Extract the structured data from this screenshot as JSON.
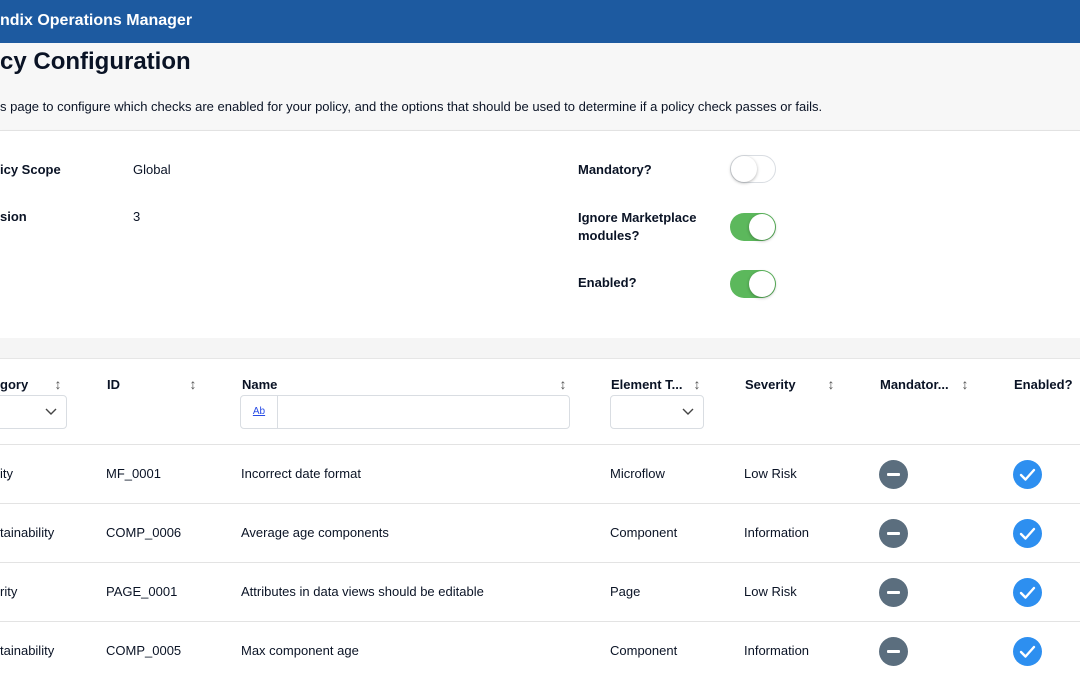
{
  "app": {
    "title": "ndix Operations Manager",
    "header_color": "#1d5aa0"
  },
  "page": {
    "title": "cy Configuration",
    "description": "s page to configure which checks are enabled for your policy, and the options that should be used to determine if a policy check passes or fails."
  },
  "settings": {
    "scope_label": "icy Scope",
    "scope_value": "Global",
    "version_label": "sion",
    "version_value": "3",
    "mandatory_label": "Mandatory?",
    "mandatory_on": false,
    "ignore_label_line1": "Ignore Marketplace",
    "ignore_label_line2": "modules?",
    "ignore_on": true,
    "enabled_label": "Enabled?",
    "enabled_on": true,
    "toggle_on_color": "#5cb85c"
  },
  "table": {
    "columns": {
      "category": "gory",
      "id": "ID",
      "name": "Name",
      "element_type": "Element T...",
      "severity": "Severity",
      "mandatory": "Mandator...",
      "enabled": "Enabled?"
    },
    "name_filter_button": "Ab",
    "name_filter_value": "",
    "category_filter_value": "",
    "element_type_filter_value": "",
    "rows": [
      {
        "category": "ity",
        "id": "MF_0001",
        "name": "Incorrect date format",
        "element_type": "Microflow",
        "severity": "Low Risk",
        "mandatory": "minus-icon",
        "enabled": "check-icon"
      },
      {
        "category": "tainability",
        "id": "COMP_0006",
        "name": "Average age components",
        "element_type": "Component",
        "severity": "Information",
        "mandatory": "minus-icon",
        "enabled": "check-icon"
      },
      {
        "category": "rity",
        "id": "PAGE_0001",
        "name": "Attributes in data views should be editable",
        "element_type": "Page",
        "severity": "Low Risk",
        "mandatory": "minus-icon",
        "enabled": "check-icon"
      },
      {
        "category": "tainability",
        "id": "COMP_0005",
        "name": "Max component age",
        "element_type": "Component",
        "severity": "Information",
        "mandatory": "minus-icon",
        "enabled": "check-icon"
      }
    ],
    "mandatory_icon_color": "#5b6e7e",
    "enabled_icon_color": "#2d8ff0"
  }
}
